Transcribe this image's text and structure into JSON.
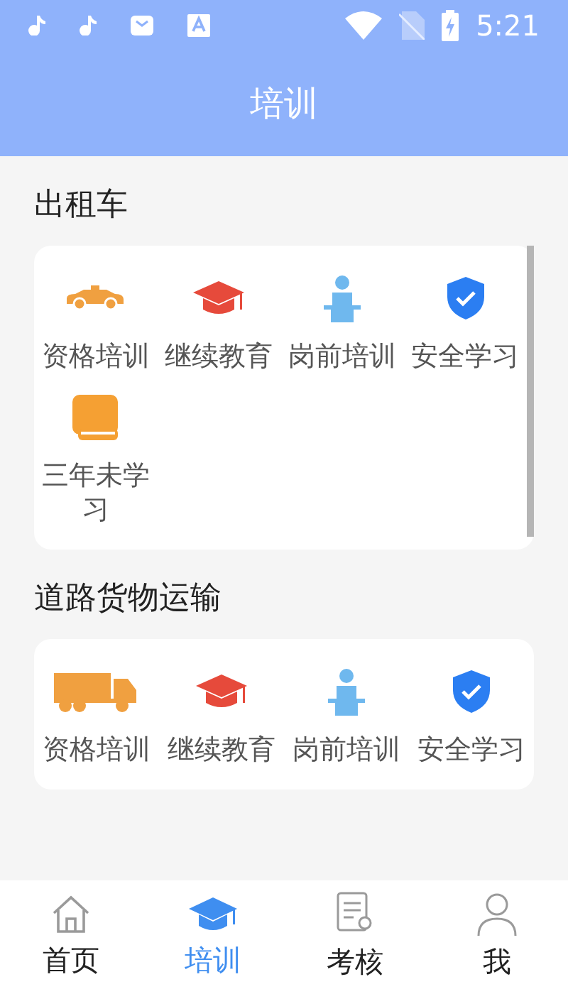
{
  "status_bar": {
    "time": "5:21"
  },
  "header": {
    "title": "培训"
  },
  "sections": [
    {
      "title": "出租车",
      "scrollable": true,
      "items": [
        {
          "label": "资格培训",
          "kind": "taxi"
        },
        {
          "label": "继续教育",
          "kind": "cap"
        },
        {
          "label": "岗前培训",
          "kind": "lecturer"
        },
        {
          "label": "安全学习",
          "kind": "shield"
        },
        {
          "label": "三年未学习",
          "kind": "book"
        }
      ]
    },
    {
      "title": "道路货物运输",
      "scrollable": false,
      "items": [
        {
          "label": "资格培训",
          "kind": "truck"
        },
        {
          "label": "继续教育",
          "kind": "cap"
        },
        {
          "label": "岗前培训",
          "kind": "lecturer"
        },
        {
          "label": "安全学习",
          "kind": "shield"
        }
      ]
    }
  ],
  "bottom_nav": [
    {
      "label": "首页",
      "kind": "home",
      "selected": false
    },
    {
      "label": "培训",
      "kind": "cap",
      "selected": true
    },
    {
      "label": "考核",
      "kind": "exam",
      "selected": false
    },
    {
      "label": "我",
      "kind": "user",
      "selected": false
    }
  ]
}
